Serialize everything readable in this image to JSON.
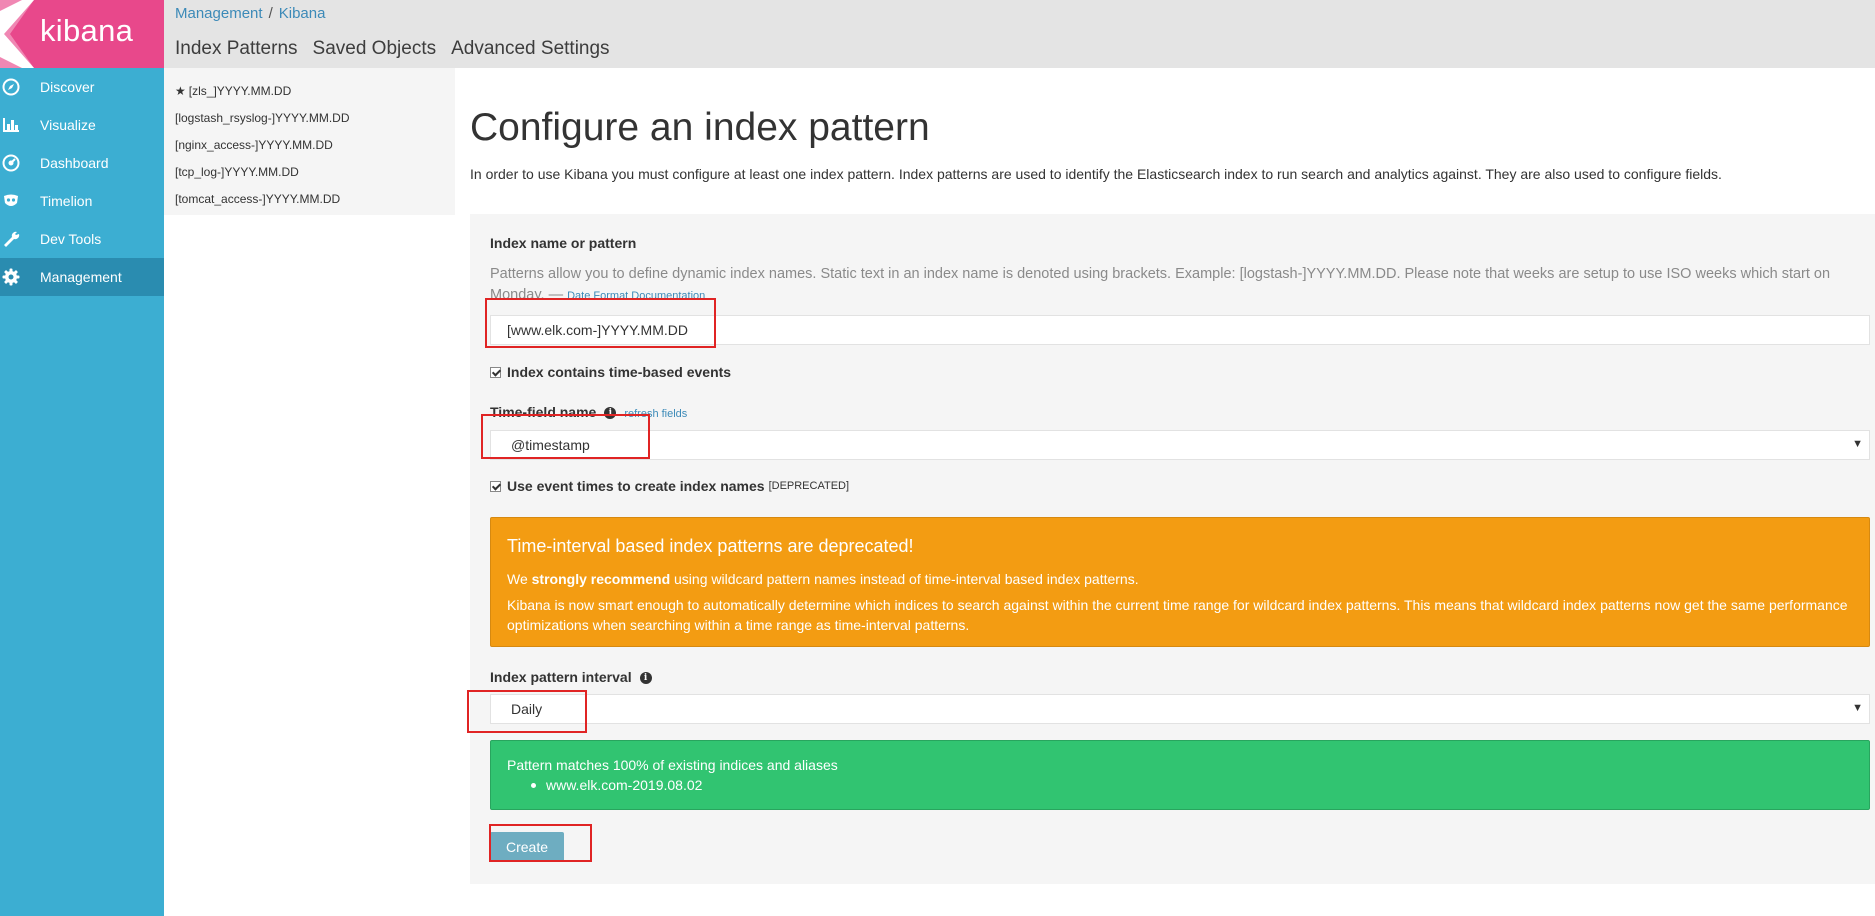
{
  "app": {
    "logo_text": "kibana",
    "brand_color": "#e8488b",
    "sidebar_color": "#3caed2"
  },
  "sidebar": {
    "items": [
      {
        "label": "Discover",
        "icon": "compass-icon"
      },
      {
        "label": "Visualize",
        "icon": "bar-chart-icon"
      },
      {
        "label": "Dashboard",
        "icon": "dashboard-gauge-icon"
      },
      {
        "label": "Timelion",
        "icon": "timelion-mask-icon"
      },
      {
        "label": "Dev Tools",
        "icon": "wrench-icon"
      },
      {
        "label": "Management",
        "icon": "gear-icon",
        "active": true
      }
    ]
  },
  "header": {
    "breadcrumb": [
      "Management",
      "Kibana"
    ],
    "breadcrumb_sep": "/",
    "tabs": [
      "Index Patterns",
      "Saved Objects",
      "Advanced Settings"
    ]
  },
  "index_patterns": [
    {
      "label": "[zls_]YYYY.MM.DD",
      "default": true
    },
    {
      "label": "[logstash_rsyslog-]YYYY.MM.DD"
    },
    {
      "label": "[nginx_access-]YYYY.MM.DD"
    },
    {
      "label": "[tcp_log-]YYYY.MM.DD"
    },
    {
      "label": "[tomcat_access-]YYYY.MM.DD"
    }
  ],
  "main": {
    "title": "Configure an index pattern",
    "description": "In order to use Kibana you must configure at least one index pattern. Index patterns are used to identify the Elasticsearch index to run search and analytics against. They are also used to configure fields.",
    "form": {
      "index_name_label": "Index name or pattern",
      "index_name_help": "Patterns allow you to define dynamic index names. Static text in an index name is denoted using brackets. Example: [logstash-]YYYY.MM.DD. Please note that weeks are setup to use ISO weeks which start on Monday. —",
      "date_format_link": "Date Format Documentation",
      "index_name_value": "[www.elk.com-]YYYY.MM.DD",
      "time_based_label": "Index contains time-based events",
      "time_field_label": "Time-field name",
      "refresh_fields": "refresh fields",
      "time_field_value": "@timestamp",
      "event_times_label": "Use event times to create index names",
      "deprecated_tag": "[DEPRECATED]",
      "interval_label": "Index pattern interval",
      "interval_value": "Daily",
      "create_button": "Create"
    },
    "warning": {
      "title": "Time-interval based index patterns are deprecated!",
      "line1_pre": "We ",
      "line1_bold": "strongly recommend",
      "line1_post": " using wildcard pattern names instead of time-interval based index patterns.",
      "line2": "Kibana is now smart enough to automatically determine which indices to search against within the current time range for wildcard index patterns. This means that wildcard index patterns now get the same performance optimizations when searching within a time range as time-interval patterns.",
      "color": "#f39c12"
    },
    "success": {
      "title": "Pattern matches 100% of existing indices and aliases",
      "items": [
        "www.elk.com-2019.08.02"
      ],
      "color": "#31c471"
    }
  }
}
